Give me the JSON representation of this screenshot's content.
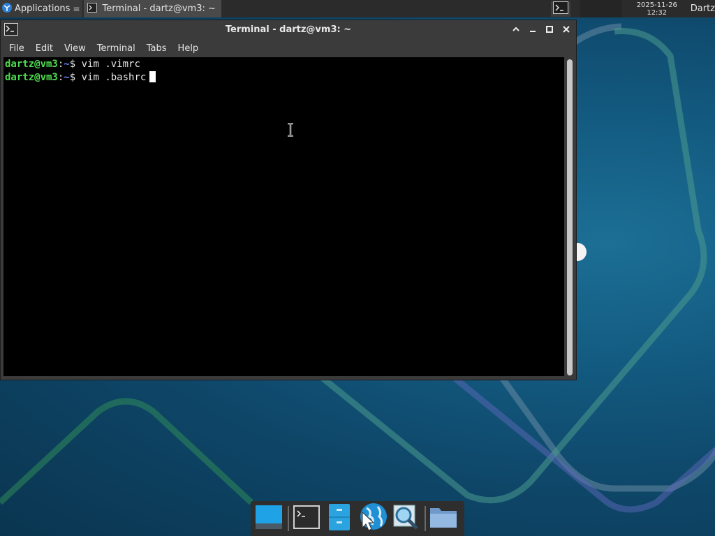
{
  "top_panel": {
    "applications_label": "Applications",
    "menu_glyph": "≡",
    "task_label": "Terminal - dartz@vm3: ~",
    "clock_date": "2025-11-26",
    "clock_time": "12:32",
    "user_label": "Dartz"
  },
  "window": {
    "title": "Terminal - dartz@vm3: ~",
    "icons": [
      "terminal-icon",
      "maximize-up-icon",
      "minimize-icon",
      "maximize-icon",
      "close-icon"
    ],
    "controls": {
      "shade": "^",
      "minimize": "–",
      "maximize": "□",
      "close": "✕"
    }
  },
  "menubar": {
    "items": [
      "File",
      "Edit",
      "View",
      "Terminal",
      "Tabs",
      "Help"
    ]
  },
  "terminal": {
    "lines": [
      {
        "user": "dartz@vm3",
        "sep": ":",
        "path": "~",
        "dollar": "$",
        "cmd": " vim .vimrc"
      },
      {
        "user": "dartz@vm3",
        "sep": ":",
        "path": "~",
        "dollar": "$",
        "cmd": " vim .bashrc"
      }
    ]
  },
  "dock": {
    "items": [
      "desktop-icon",
      "terminal-icon",
      "file-manager-icon",
      "web-browser-icon",
      "search-icon",
      "folder-icon"
    ]
  },
  "colors": {
    "prompt_user": "#4fdc4f",
    "prompt_path": "#6a84ff",
    "terminal_bg": "#000000",
    "panel_bg": "#2b2b2b",
    "desktop_bg": "#0e4668"
  }
}
